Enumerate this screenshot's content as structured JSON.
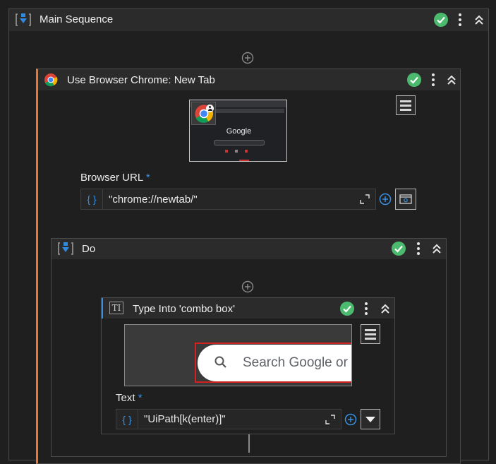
{
  "main_sequence": {
    "title": "Main Sequence"
  },
  "use_browser": {
    "title": "Use Browser Chrome: New Tab",
    "thumbnail_text": "Google",
    "url_label": "Browser URL",
    "required_mark": "*",
    "url_value": "\"chrome://newtab/\"",
    "brace": "{ }"
  },
  "do_seq": {
    "title": "Do"
  },
  "type_into": {
    "title": "Type Into 'combo box'",
    "search_placeholder": "Search Google or",
    "text_label": "Text",
    "required_mark": "*",
    "text_value": "\"UiPath[k(enter)]\"",
    "brace": "{ }"
  },
  "colors": {
    "accent_orange": "#e8782c",
    "success_green": "#4cba6e",
    "accent_blue": "#3a8fe0",
    "highlight_red": "#d32020"
  }
}
